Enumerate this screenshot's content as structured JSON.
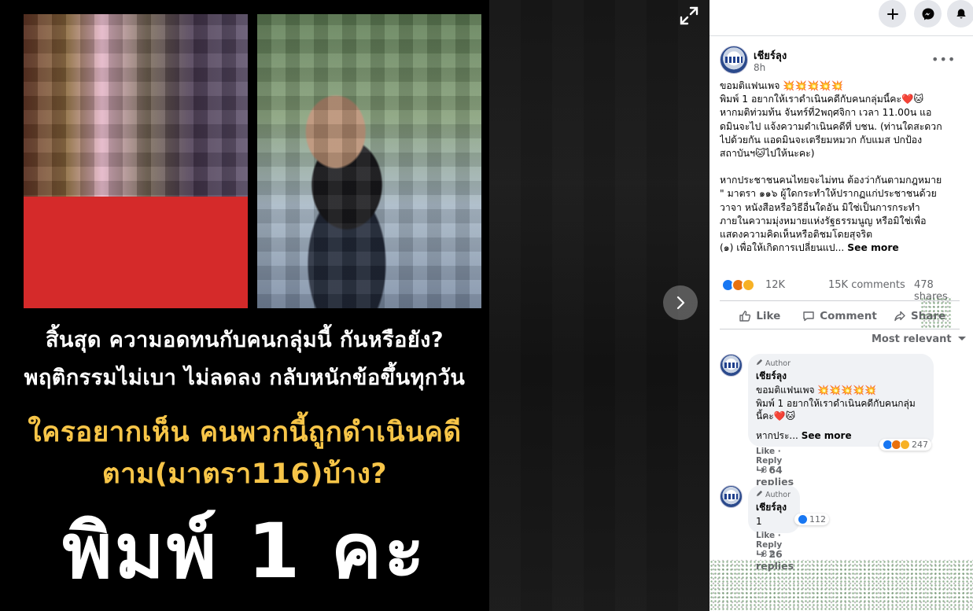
{
  "poster": {
    "line1": "สิ้นสุด ความอดทนกับคนกลุ่มนี้ กันหรือยัง?",
    "line2": "พฤติกรรมไม่เบา ไม่ลดลง กลับหนักข้อขึ้นทุกวัน",
    "line3": "ใครอยากเห็น คนพวกนี้ถูกดำเนินคดี",
    "line4": "ตาม(มาตรา116)บ้าง?",
    "line5": "พิมพ์ 1 คะ"
  },
  "post": {
    "page_name": "เชียร์ลุง",
    "time": "8h",
    "more": "•••",
    "lines": [
      "ขอมติแฟนเพจ 💥💥💥💥💥",
      "พิมพ์ 1 อยากให้เราดำเนินคดีกับคนกลุ่มนี้คะ❤️🐱",
      "หากมติท่วมท้น จันทร์ที่2พฤศจิกา เวลา 11.00น แอ",
      "ดมินจะไป แจ้งความดำเนินคดีที่ บชน. (ท่านใดสะดวก",
      "ไปด้วยกัน แอดมินจะเตรียมหมวก กับแมส ปกป้อง",
      "สถาบันฯ🐱ไปให้นะคะ)",
      "",
      "หากประชาชนคนไทยจะไม่ทน ต้องว่ากันตามกฎหมาย",
      "\" มาตรา ๑๑๖ ผู้ใดกระทำให้ปรากฏแก่ประชาชนด้วย",
      "วาจา หนังสือหรือวิธีอื่นใดอัน มิใช่เป็นการกระทำ",
      "ภายในความมุ่งหมายแห่งรัฐธรรมนูญ หรือมิใช่เพื่อ",
      "แสดงความคิดเห็นหรือติชมโดยสุจริต"
    ],
    "last_line": "(๑) เพื่อให้เกิดการเปลี่ยนแป...",
    "see_more": "See more",
    "reaction_count": "12K",
    "comments_count": "15K comments",
    "shares_count": "478 shares",
    "like_label": "Like",
    "comment_label": "Comment",
    "share_label": "Share",
    "sort_label": "Most relevant"
  },
  "comments": [
    {
      "author_tag": "Author",
      "name": "เชียร์ลุง",
      "line1": "ขอมติแฟนเพจ 💥💥💥💥💥",
      "line2": "พิมพ์ 1 อยากให้เราดำเนินคดีกับคนกลุ่ม",
      "line3": "นี้คะ❤️🐱",
      "line4": "หากประ...",
      "see_more": "See more",
      "like": "Like",
      "reply": "Reply",
      "time": "8 h",
      "reactions": "247",
      "replies": "64 replies"
    },
    {
      "author_tag": "Author",
      "name": "เชียร์ลุง",
      "line1": "1",
      "like": "Like",
      "reply": "Reply",
      "time": "8 h",
      "reactions": "112",
      "replies": "26 replies"
    }
  ],
  "colors": {
    "accent": "#1877f2",
    "poster_yellow": "#f7c548",
    "panel_bg": "#ffffff",
    "secondary_text": "#65676b"
  },
  "icons": [
    "expand-icon",
    "chevron-right-icon",
    "plus-icon",
    "messenger-icon",
    "bell-icon",
    "like-icon",
    "comment-icon",
    "share-icon",
    "caret-down-icon",
    "reply-arrow-icon",
    "pencil-icon"
  ]
}
